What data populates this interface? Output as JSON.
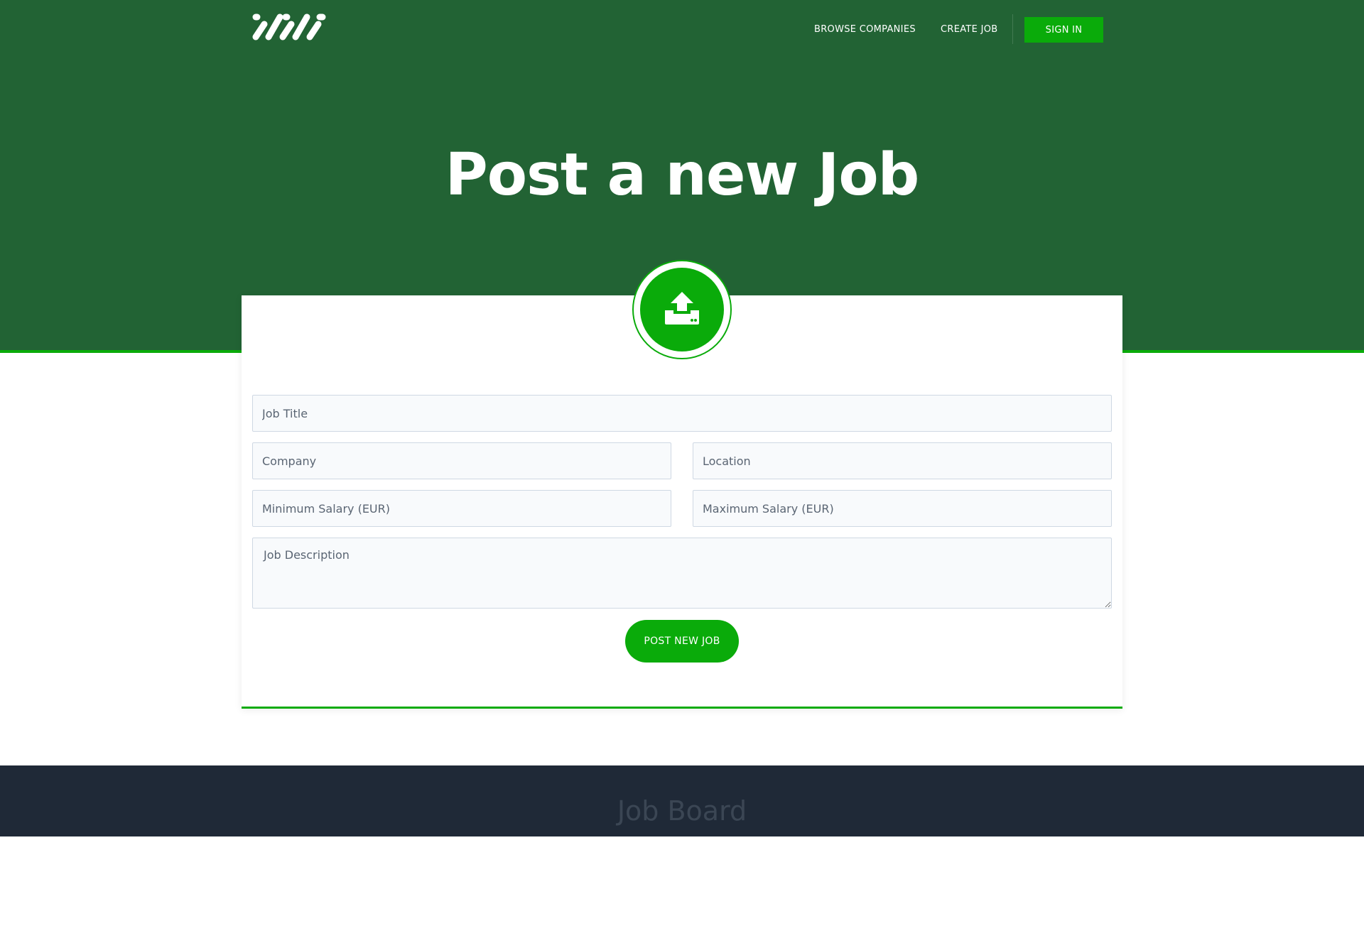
{
  "nav": {
    "browse_companies": "BROWSE COMPANIES",
    "create_job": "CREATE JOB",
    "sign_in": "SIGN IN"
  },
  "hero": {
    "title": "Post a new Job"
  },
  "form": {
    "job_title_placeholder": "Job Title",
    "company_placeholder": "Company",
    "location_placeholder": "Location",
    "min_salary_placeholder": "Minimum Salary (EUR)",
    "max_salary_placeholder": "Maximum Salary (EUR)",
    "description_placeholder": "Job Description",
    "submit_label": "POST NEW JOB"
  },
  "icons": {
    "logo": "logo-icon",
    "upload": "upload-icon"
  },
  "colors": {
    "hero_bg": "#226334",
    "accent": "#0aab0a",
    "footer_bg": "#1f2937"
  },
  "footer": {
    "title": "Job Board"
  }
}
